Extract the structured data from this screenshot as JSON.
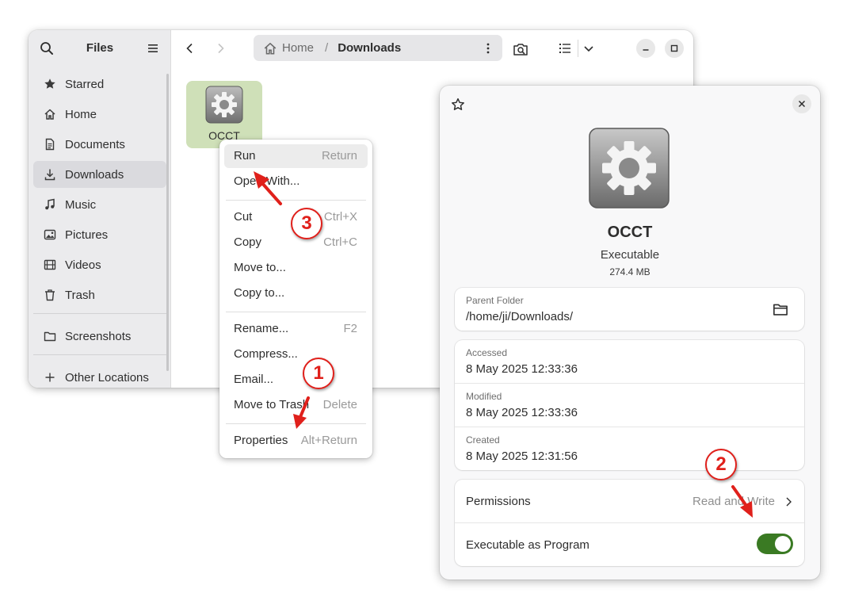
{
  "files_window": {
    "title": "Files",
    "sidebar": {
      "items": [
        {
          "label": "Starred",
          "icon": "star-icon"
        },
        {
          "label": "Home",
          "icon": "home-icon"
        },
        {
          "label": "Documents",
          "icon": "document-icon"
        },
        {
          "label": "Downloads",
          "icon": "download-icon",
          "active": true
        },
        {
          "label": "Music",
          "icon": "music-icon"
        },
        {
          "label": "Pictures",
          "icon": "picture-icon"
        },
        {
          "label": "Videos",
          "icon": "video-icon"
        },
        {
          "label": "Trash",
          "icon": "trash-icon"
        }
      ],
      "bookmarks": [
        {
          "label": "Screenshots",
          "icon": "folder-icon"
        }
      ],
      "other_locations": {
        "label": "Other Locations",
        "icon": "plus-icon"
      }
    },
    "pathbar": {
      "home": "Home",
      "separator": "/",
      "current": "Downloads"
    },
    "file": {
      "name": "OCCT",
      "icon": "executable-gear-icon"
    },
    "selection_color": "#cfe0b8"
  },
  "context_menu": {
    "items": [
      {
        "label": "Run",
        "accel": "Return",
        "hover": true
      },
      {
        "label": "Open With...",
        "accel": ""
      },
      {
        "label": "Cut",
        "accel": "Ctrl+X"
      },
      {
        "label": "Copy",
        "accel": "Ctrl+C"
      },
      {
        "label": "Move to...",
        "accel": ""
      },
      {
        "label": "Copy to...",
        "accel": ""
      },
      {
        "label": "Rename...",
        "accel": "F2"
      },
      {
        "label": "Compress...",
        "accel": ""
      },
      {
        "label": "Email...",
        "accel": ""
      },
      {
        "label": "Move to Trash",
        "accel": "Delete"
      },
      {
        "label": "Properties",
        "accel": "Alt+Return"
      }
    ]
  },
  "properties": {
    "name": "OCCT",
    "type": "Executable",
    "size": "274.4 MB",
    "parent_folder": {
      "caption": "Parent Folder",
      "value": "/home/ji/Downloads/"
    },
    "times": [
      {
        "caption": "Accessed",
        "value": "8 May 2025 12:33:36"
      },
      {
        "caption": "Modified",
        "value": "8 May 2025 12:33:36"
      },
      {
        "caption": "Created",
        "value": "8 May 2025 12:31:56"
      }
    ],
    "permissions": {
      "label": "Permissions",
      "value": "Read and Write"
    },
    "executable": {
      "label": "Executable as Program",
      "enabled": true
    },
    "toggle_color": "#3a7a23"
  },
  "annotations": {
    "badges": [
      "1",
      "2",
      "3"
    ],
    "color": "#e0201b"
  }
}
